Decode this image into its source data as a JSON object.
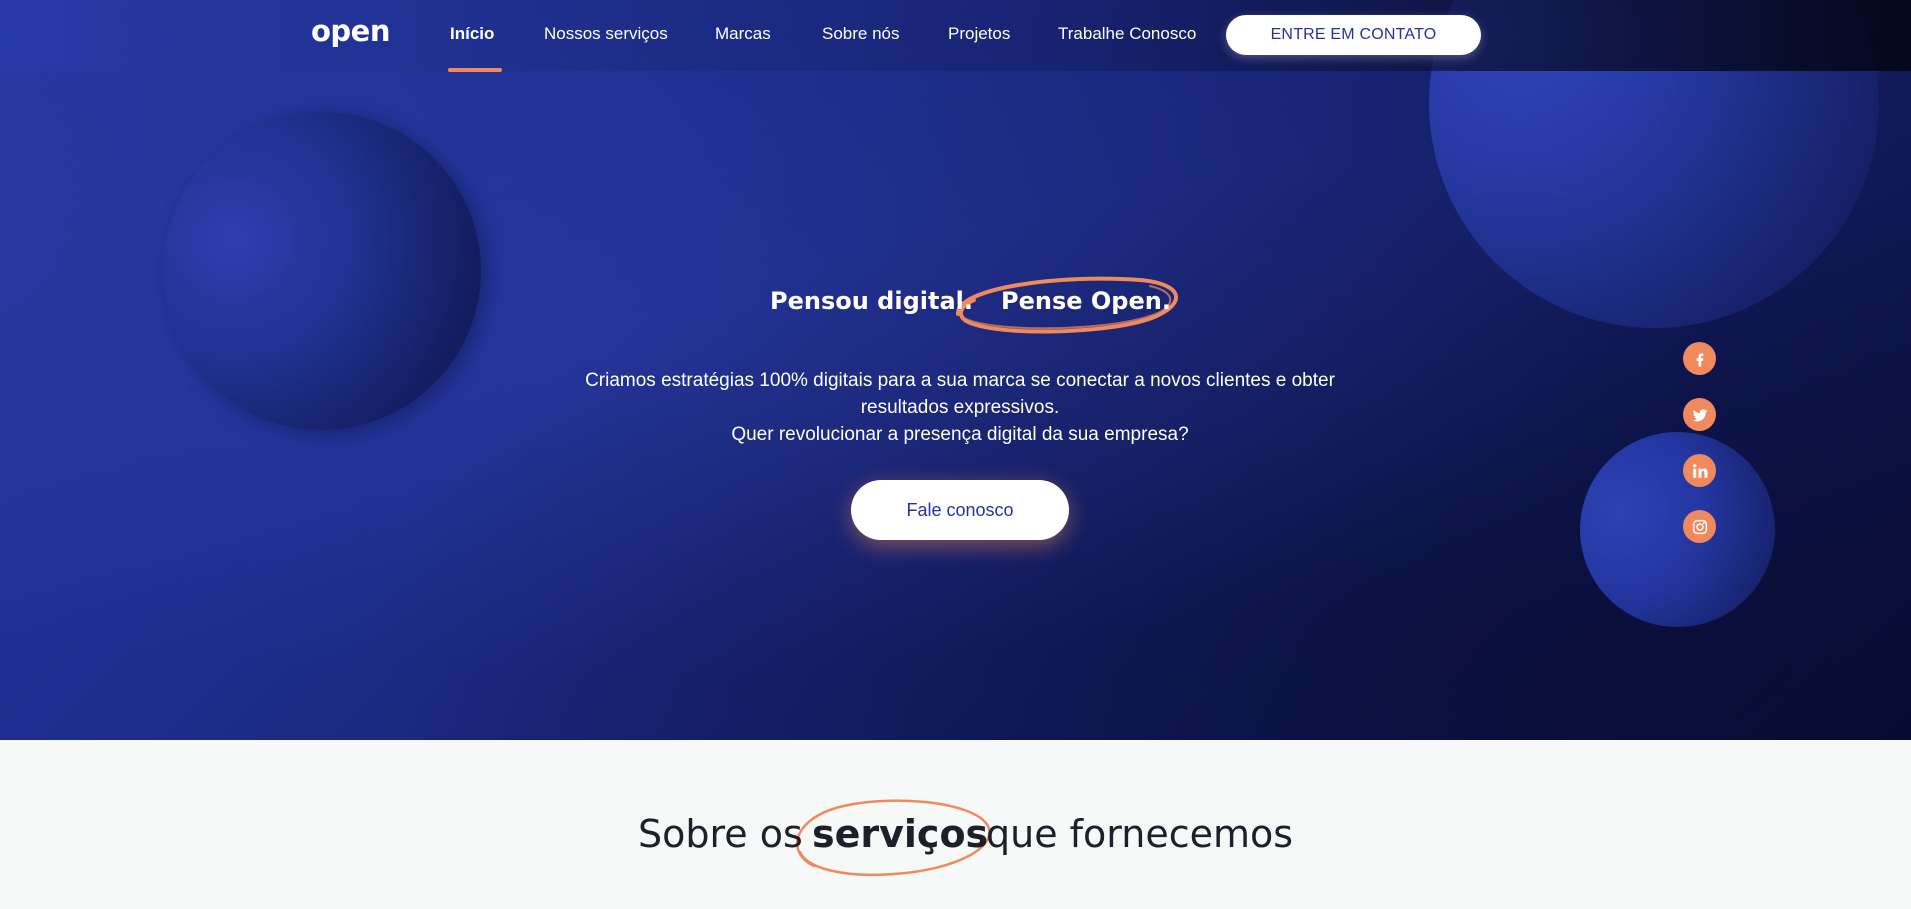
{
  "brand": {
    "logo_text": "open"
  },
  "nav": {
    "items": [
      {
        "label": "Início",
        "active": true
      },
      {
        "label": "Nossos serviços",
        "active": false
      },
      {
        "label": "Marcas",
        "active": false
      },
      {
        "label": "Sobre nós",
        "active": false
      },
      {
        "label": "Projetos",
        "active": false
      },
      {
        "label": "Trabalhe Conosco",
        "active": false
      }
    ],
    "cta_label": "ENTRE EM CONTATO"
  },
  "hero": {
    "headline_part1": "Pensou digital.",
    "headline_part2": "Pense Open.",
    "paragraph_lines": [
      "Criamos estratégias 100% digitais para a sua marca se conectar a novos clientes e obter",
      "resultados expressivos.",
      "Quer revolucionar a presença digital da sua empresa?"
    ],
    "button_label": "Fale conosco"
  },
  "social": [
    {
      "name": "facebook-icon"
    },
    {
      "name": "twitter-icon"
    },
    {
      "name": "linkedin-icon"
    },
    {
      "name": "instagram-icon"
    }
  ],
  "services": {
    "title_part1": "Sobre os",
    "title_highlight": "serviços",
    "title_part2": "que fornecemos"
  },
  "colors": {
    "accent": "#f08a5d",
    "brand_blue": "#2133a6",
    "text_dark": "#1f1f2a",
    "white": "#ffffff"
  }
}
